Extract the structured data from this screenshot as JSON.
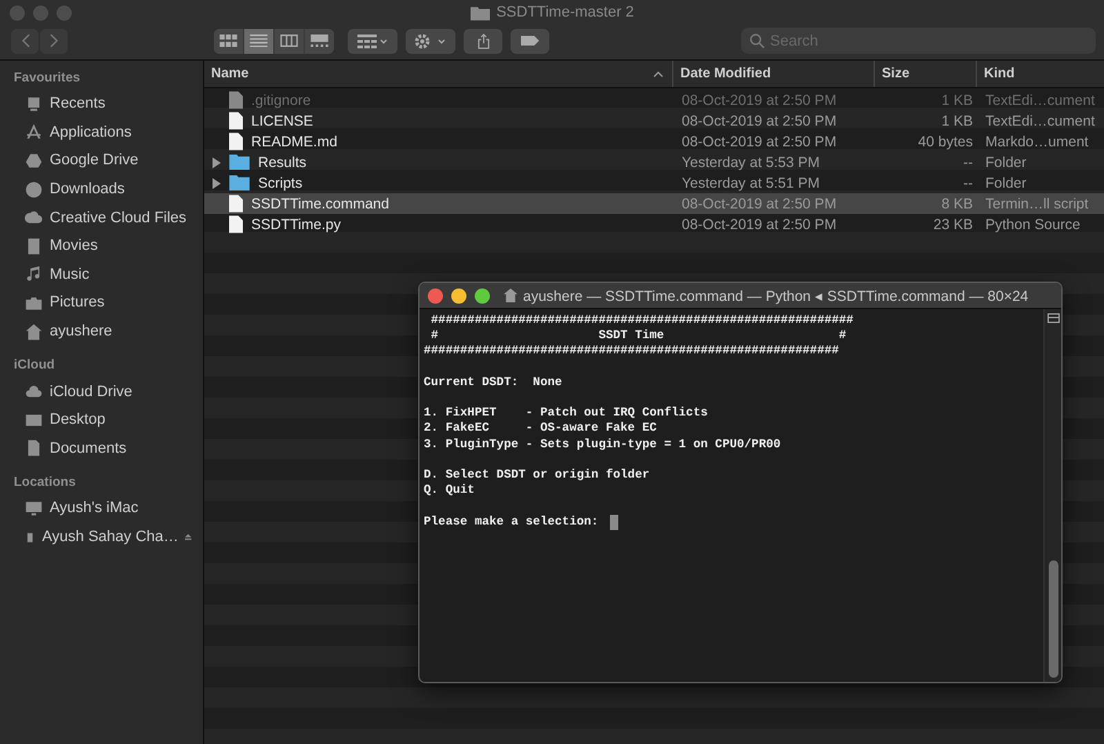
{
  "window": {
    "title": "SSDTTime-master 2"
  },
  "toolbar": {
    "view_modes": [
      {
        "selected": false
      },
      {
        "selected": true
      },
      {
        "selected": false
      },
      {
        "selected": false
      }
    ],
    "search": {
      "placeholder": "Search"
    }
  },
  "sidebar": {
    "sections": [
      {
        "heading": "Favourites",
        "items": [
          {
            "label": "Recents"
          },
          {
            "label": "Applications"
          },
          {
            "label": "Google Drive"
          },
          {
            "label": "Downloads"
          },
          {
            "label": "Creative Cloud Files"
          },
          {
            "label": "Movies"
          },
          {
            "label": "Music"
          },
          {
            "label": "Pictures"
          },
          {
            "label": "ayushere"
          }
        ]
      },
      {
        "heading": "iCloud",
        "items": [
          {
            "label": "iCloud Drive"
          },
          {
            "label": "Desktop"
          },
          {
            "label": "Documents"
          }
        ]
      },
      {
        "heading": "Locations",
        "items": [
          {
            "label": "Ayush's iMac",
            "ejectable": false
          },
          {
            "label": "Ayush Sahay Cha…",
            "ejectable": true
          }
        ]
      }
    ]
  },
  "columns": [
    {
      "label": "Name",
      "sorted": true
    },
    {
      "label": "Date Modified",
      "sorted": false
    },
    {
      "label": "Size",
      "sorted": false
    },
    {
      "label": "Kind",
      "sorted": false
    }
  ],
  "files": [
    {
      "name": ".gitignore",
      "kind": "file",
      "date": "08-Oct-2019 at 2:50 PM",
      "size": "1 KB",
      "file_kind": "TextEdi…cument",
      "selected": false,
      "dimmed": true
    },
    {
      "name": "LICENSE",
      "kind": "file",
      "date": "08-Oct-2019 at 2:50 PM",
      "size": "1 KB",
      "file_kind": "TextEdi…cument",
      "selected": false,
      "dimmed": false
    },
    {
      "name": "README.md",
      "kind": "file",
      "date": "08-Oct-2019 at 2:50 PM",
      "size": "40 bytes",
      "file_kind": "Markdo…ument",
      "selected": false,
      "dimmed": false
    },
    {
      "name": "Results",
      "kind": "folder",
      "expanded": false,
      "date": "Yesterday at 5:53 PM",
      "size": "--",
      "file_kind": "Folder",
      "selected": false,
      "dimmed": false
    },
    {
      "name": "Scripts",
      "kind": "folder",
      "expanded": false,
      "date": "Yesterday at 5:51 PM",
      "size": "--",
      "file_kind": "Folder",
      "selected": false,
      "dimmed": false
    },
    {
      "name": "SSDTTime.command",
      "kind": "file",
      "date": "08-Oct-2019 at 2:50 PM",
      "size": "8 KB",
      "file_kind": "Termin…ll script",
      "selected": true,
      "dimmed": false
    },
    {
      "name": "SSDTTime.py",
      "kind": "file",
      "date": "08-Oct-2019 at 2:50 PM",
      "size": "23 KB",
      "file_kind": "Python Source",
      "selected": false,
      "dimmed": false
    }
  ],
  "terminal": {
    "title": "ayushere — SSDTTime.command — Python ◂ SSDTTime.command — 80×24",
    "blocks": [
      [
        " ##########################################################",
        " #                      SSDT Time                        #",
        "#########################################################"
      ],
      [
        "Current DSDT:  None"
      ],
      [
        "1. FixHPET    - Patch out IRQ Conflicts",
        "2. FakeEC     - OS-aware Fake EC",
        "3. PluginType - Sets plugin-type = 1 on CPU0/PR00"
      ],
      [
        "D. Select DSDT or origin folder",
        "Q. Quit"
      ]
    ],
    "prompt": "Please make a selection:"
  }
}
